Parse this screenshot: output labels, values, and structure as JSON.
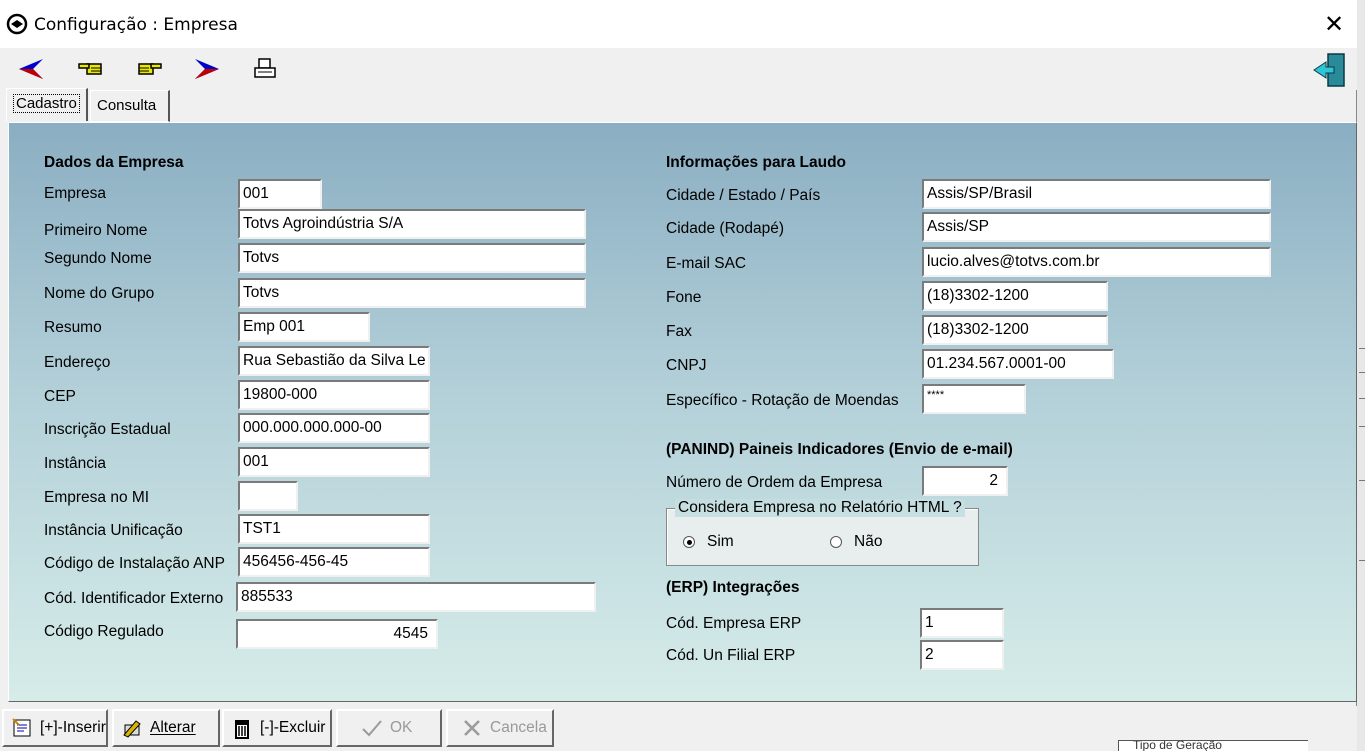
{
  "window": {
    "title": "Configuração : Empresa",
    "close_label": "✕"
  },
  "toolbar": {
    "buttons": [
      {
        "name": "first-record",
        "icon": "blue-arrow-left-icon"
      },
      {
        "name": "previous-record",
        "icon": "hand-pointing-left-icon"
      },
      {
        "name": "next-record",
        "icon": "hand-pointing-right-icon"
      },
      {
        "name": "last-record",
        "icon": "blue-arrow-right-icon"
      },
      {
        "name": "print",
        "icon": "printer-icon"
      }
    ],
    "exit_icon": "exit-door-icon"
  },
  "tabs": [
    {
      "label": "Cadastro",
      "active": true
    },
    {
      "label": "Consulta",
      "active": false
    }
  ],
  "left": {
    "header": "Dados da Empresa",
    "fields": {
      "empresa": {
        "label": "Empresa",
        "value": "001"
      },
      "primeiro_nome": {
        "label": "Primeiro Nome",
        "value": "Totvs Agroindústria S/A"
      },
      "segundo_nome": {
        "label": "Segundo Nome",
        "value": "Totvs"
      },
      "nome_grupo": {
        "label": "Nome do Grupo",
        "value": "Totvs"
      },
      "resumo": {
        "label": "Resumo",
        "value": "Emp 001"
      },
      "endereco": {
        "label": "Endereço",
        "value": "Rua Sebastião da Silva Le"
      },
      "cep": {
        "label": "CEP",
        "value": "19800-000"
      },
      "inscricao": {
        "label": "Inscrição Estadual",
        "value": "000.000.000.000-00"
      },
      "instancia": {
        "label": "Instância",
        "value": "001"
      },
      "empresa_mi": {
        "label": "Empresa no MI",
        "value": ""
      },
      "instancia_unif": {
        "label": "Instância Unificação",
        "value": "TST1"
      },
      "cod_anp": {
        "label": "Código de Instalação ANP",
        "value": "456456-456-45"
      },
      "cod_ext": {
        "label": "Cód. Identificador Externo",
        "value": "885533"
      },
      "cod_regulado": {
        "label": "Código Regulado",
        "value": "4545"
      }
    }
  },
  "right": {
    "laudo_header": "Informações para Laudo",
    "cidade_estado": {
      "label": "Cidade / Estado / País",
      "value": "Assis/SP/Brasil"
    },
    "cidade_rodape": {
      "label": "Cidade (Rodapé)",
      "value": "Assis/SP"
    },
    "email_sac": {
      "label": "E-mail SAC",
      "value": "lucio.alves@totvs.com.br"
    },
    "fone": {
      "label": "Fone",
      "value": "(18)3302-1200"
    },
    "fax": {
      "label": "Fax",
      "value": "(18)3302-1200"
    },
    "cnpj": {
      "label": "CNPJ",
      "value": "01.234.567.0001-00"
    },
    "especifico": {
      "label": "Específico - Rotação de Moendas",
      "value": "****"
    },
    "panind_header": "(PANIND) Paineis Indicadores (Envio de e-mail)",
    "numero_ordem": {
      "label": "Número de Ordem da Empresa",
      "value": "2"
    },
    "html_group": {
      "title": "Considera Empresa no Relatório HTML ?",
      "options": [
        {
          "label": "Sim",
          "selected": true
        },
        {
          "label": "Não",
          "selected": false
        }
      ]
    },
    "erp_header": "(ERP) Integrações",
    "cod_empresa_erp": {
      "label": "Cód. Empresa ERP",
      "value": "1"
    },
    "cod_filial_erp": {
      "label": "Cód. Un Filial ERP",
      "value": "2"
    }
  },
  "bottom_bar": {
    "inserir": {
      "label": "[+]-Inserir",
      "icon": "insert-record-icon",
      "enabled": true
    },
    "alterar": {
      "label": "Alterar",
      "icon": "edit-pencil-icon",
      "enabled": true
    },
    "excluir": {
      "label": "[-]-Excluir",
      "icon": "trash-can-icon",
      "enabled": true
    },
    "ok": {
      "label": "OK",
      "icon": "checkmark-icon",
      "enabled": false
    },
    "cancela": {
      "label": "Cancela",
      "icon": "cancel-x-icon",
      "enabled": false
    }
  },
  "background_peek": "Tipo de Geração"
}
